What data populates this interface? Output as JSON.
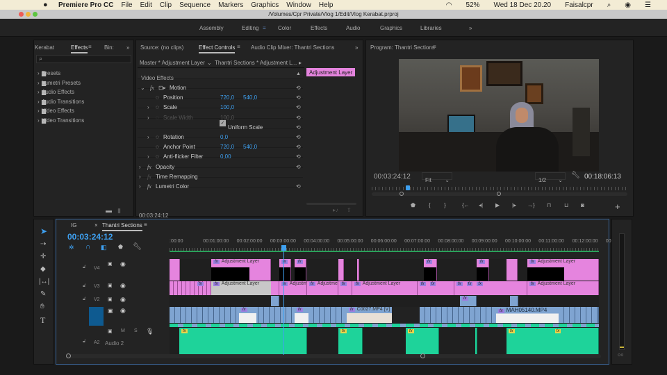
{
  "menubar": {
    "app": "Premiere Pro CC",
    "items": [
      "File",
      "Edit",
      "Clip",
      "Sequence",
      "Markers",
      "Graphics",
      "Window",
      "Help"
    ],
    "battery": "52%",
    "datetime": "Wed 18 Dec  20.20",
    "user": "Faisalcpr"
  },
  "window": {
    "title": "/Volumes/Cpr Private/Vlog 1/Edit/Vlog Kerabat.prproj"
  },
  "workspaces": {
    "items": [
      "Assembly",
      "Editing",
      "Color",
      "Effects",
      "Audio",
      "Graphics",
      "Libraries"
    ],
    "active": "Editing",
    "more": "»"
  },
  "project_panel": {
    "tabs": [
      "Kerabat",
      "Effects",
      "Bin:"
    ],
    "active": "Effects",
    "more": "»",
    "search_placeholder": "",
    "folders": [
      "Presets",
      "Lumetri Presets",
      "Audio Effects",
      "Audio Transitions",
      "Video Effects",
      "Video Transitions"
    ]
  },
  "effect_controls": {
    "tabs": [
      "Source: (no clips)",
      "Effect Controls",
      "Audio Clip Mixer: Thantri Sections"
    ],
    "active": "Effect Controls",
    "more": "»",
    "master": "Master * Adjustment Layer",
    "sequence_clip": "Thantri Sections * Adjustment L...",
    "section": "Video Effects",
    "mini_clip": "Adjustment Layer",
    "timecode": "00:03:24:12",
    "rows": [
      {
        "name": "Motion",
        "kind": "fx"
      },
      {
        "name": "Position",
        "v1": "720,0",
        "v2": "540,0"
      },
      {
        "name": "Scale",
        "v1": "100,0"
      },
      {
        "name": "Scale Width",
        "v1": "100,0",
        "disabled": true
      },
      {
        "name": "Uniform Scale",
        "checked": true
      },
      {
        "name": "Rotation",
        "v1": "0,0"
      },
      {
        "name": "Anchor Point",
        "v1": "720,0",
        "v2": "540,0"
      },
      {
        "name": "Anti-flicker Filter",
        "v1": "0,00"
      },
      {
        "name": "Opacity",
        "kind": "fx"
      },
      {
        "name": "Time Remapping",
        "kind": "fx"
      },
      {
        "name": "Lumetri Color",
        "kind": "fx"
      }
    ]
  },
  "program": {
    "title": "Program: Thantri Sections",
    "timecode": "00:03:24:12",
    "zoom": "Fit",
    "resolution": "1/2",
    "duration": "00:18:06:13",
    "playhead_fraction": 0.2
  },
  "timeline": {
    "tabs": [
      "IG",
      "Thantri Sections"
    ],
    "active": "Thantri Sections",
    "timecode": "00:03:24:12",
    "ruler": [
      ":00:00",
      "00:01:00:00",
      "00:02:00:00",
      "00:03:00:00",
      "00:04:00:00",
      "00:05:00:00",
      "00:06:00:00",
      "00:07:00:00",
      "00:08:00:00",
      "00:09:00:00",
      "00:10:00:00",
      "00:11:00:00",
      "00:12:00:00",
      "00"
    ],
    "tracks": {
      "v4": "V4",
      "v3": "V3",
      "v2": "V2",
      "a2": "A2",
      "a2_name": "Audio 2",
      "m": "M",
      "s": "S"
    },
    "clips": {
      "adj": "Adjustment Layer",
      "adj_short": "Adjustm",
      "adj_short2": "Adjustme",
      "c0027": "C0027.MP4 [V]",
      "mah": "MAH05140.MP4",
      "fx": "fx"
    }
  },
  "colors": {
    "accent": "#3ea0f0",
    "adjustment": "#e584de",
    "video": "#7fa4d1",
    "audio": "#1ed39a"
  }
}
